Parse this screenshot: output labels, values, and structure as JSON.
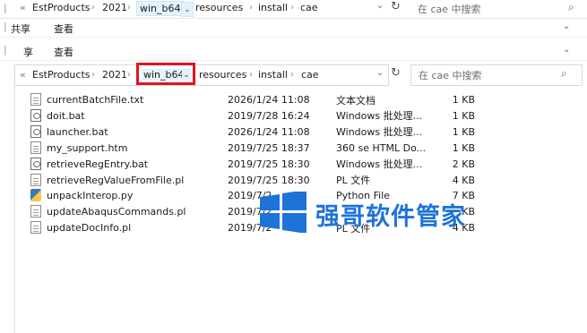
{
  "top_strip": {
    "back_symbol": "«",
    "path": [
      "EstProducts",
      "2021",
      "win_b64",
      "resources",
      "install",
      "cae"
    ],
    "search_placeholder": "在 cae 中搜索"
  },
  "ribbon1": {
    "tabs": [
      "共享",
      "查看"
    ],
    "partial_tab_left": "共享"
  },
  "ribbon2": {
    "tabs": [
      "享",
      "查看"
    ]
  },
  "address": {
    "back_symbol": "«",
    "path": [
      "EstProducts",
      "2021",
      "win_b64",
      "resources",
      "install",
      "cae"
    ],
    "highlighted": "win_b64",
    "highlight_color": "#e0141e",
    "search_placeholder": "在 cae 中搜索"
  },
  "files": [
    {
      "name": "currentBatchFile.txt",
      "date": "2026/1/24 11:08",
      "type": "文本文档",
      "size": "1 KB",
      "icon": "txt-file-icon"
    },
    {
      "name": "doit.bat",
      "date": "2019/7/28 16:24",
      "type": "Windows 批处理...",
      "size": "1 KB",
      "icon": "bat-file-icon"
    },
    {
      "name": "launcher.bat",
      "date": "2026/1/24 11:08",
      "type": "Windows 批处理...",
      "size": "1 KB",
      "icon": "bat-file-icon"
    },
    {
      "name": "my_support.htm",
      "date": "2019/7/25 18:37",
      "type": "360 se HTML Do...",
      "size": "1 KB",
      "icon": "htm-file-icon"
    },
    {
      "name": "retrieveRegEntry.bat",
      "date": "2019/7/25 18:30",
      "type": "Windows 批处理...",
      "size": "2 KB",
      "icon": "bat-file-icon"
    },
    {
      "name": "retrieveRegValueFromFile.pl",
      "date": "2019/7/25 18:30",
      "type": "PL 文件",
      "size": "4 KB",
      "icon": "pl-file-icon"
    },
    {
      "name": "unpackInterop.py",
      "date": "2019/7/2",
      "type": "Python File",
      "size": "7 KB",
      "icon": "py-file-icon"
    },
    {
      "name": "updateAbaqusCommands.pl",
      "date": "2019/7/2",
      "type": "",
      "size": "KB",
      "icon": "pl-file-icon"
    },
    {
      "name": "updateDocInfo.pl",
      "date": "2019/7/2",
      "type": "PL 文件",
      "size": "4 KB",
      "icon": "pl-file-icon"
    }
  ],
  "watermark": {
    "text": "强哥软件管家",
    "color": "#1e73d8",
    "logo": "windows-logo"
  }
}
